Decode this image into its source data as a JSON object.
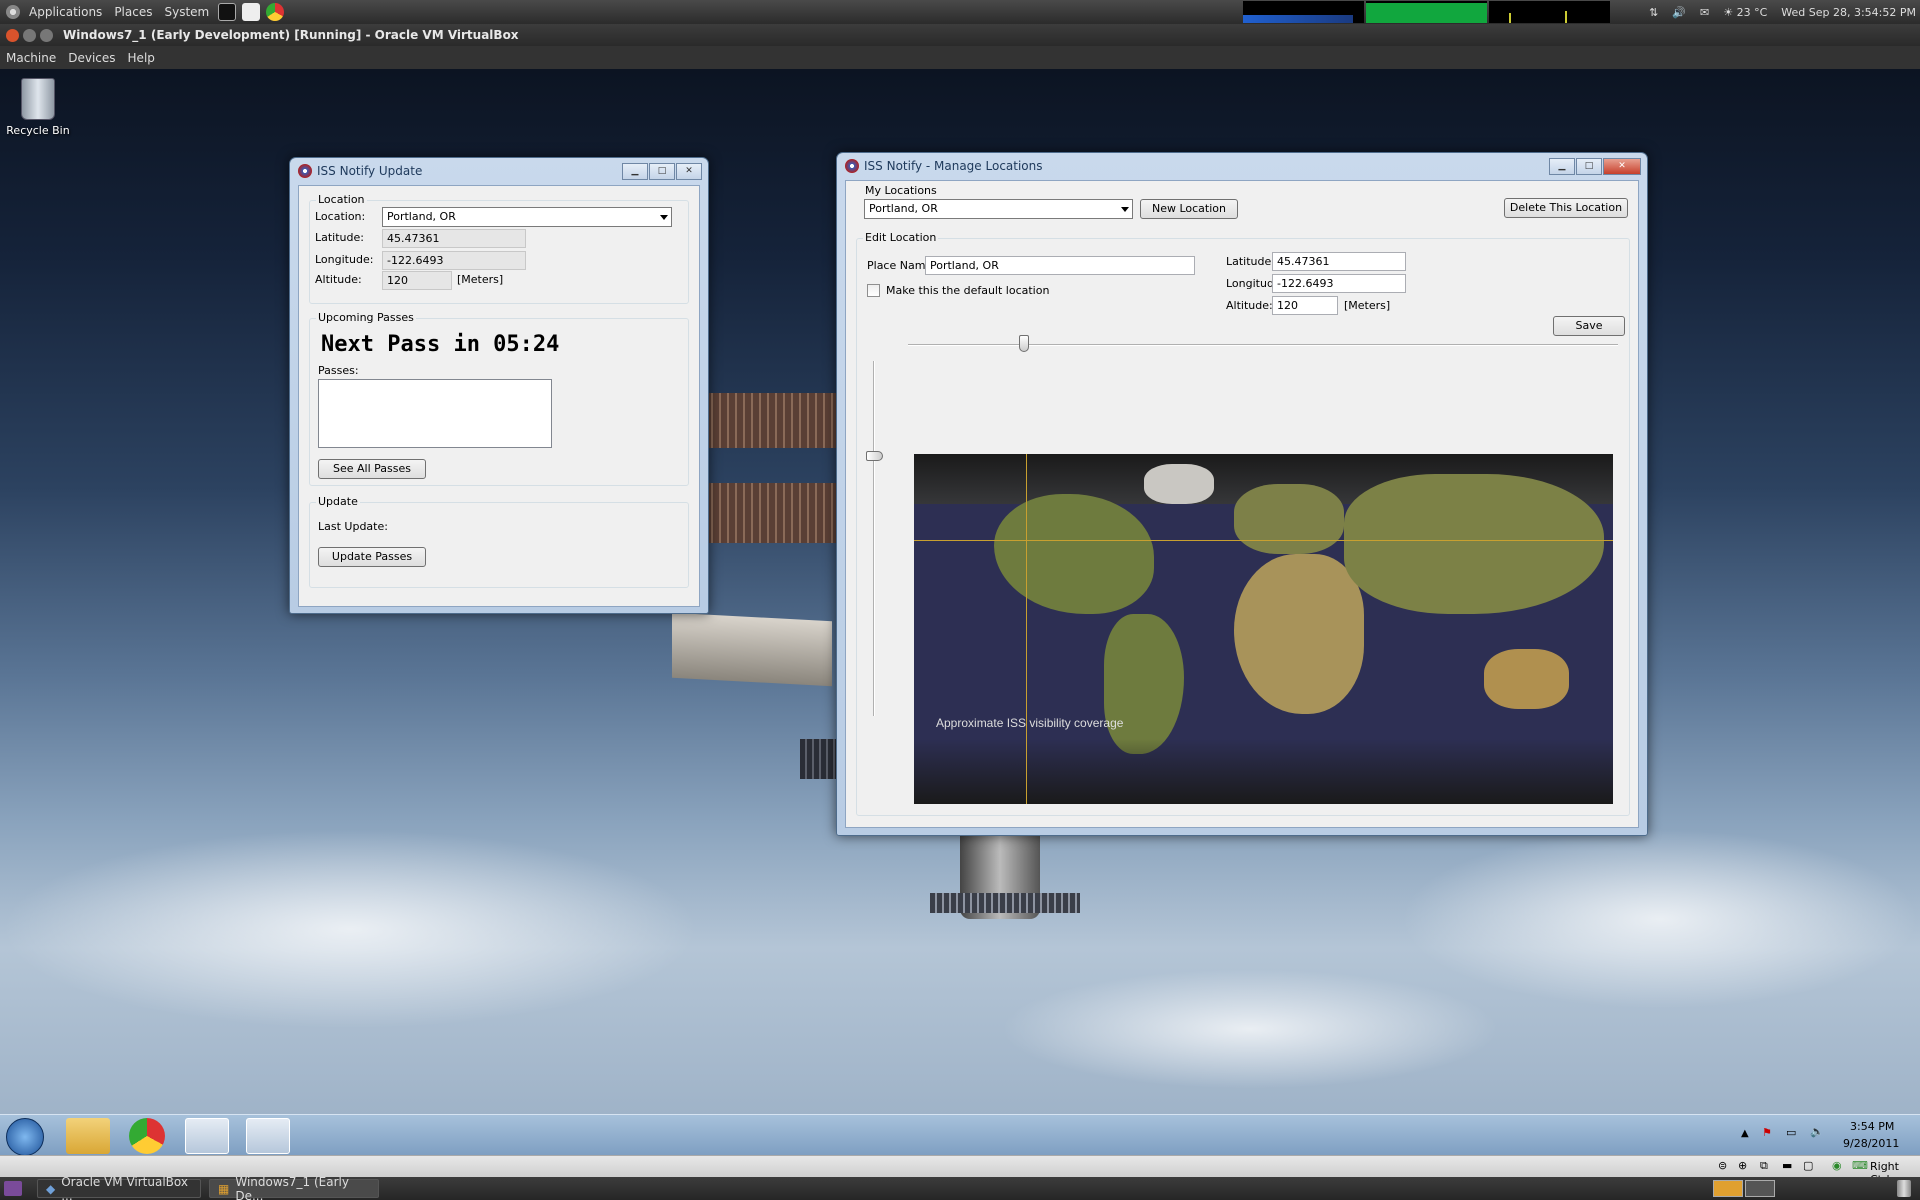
{
  "host_panel": {
    "menus": [
      "Applications",
      "Places",
      "System"
    ],
    "temperature": "23 °C",
    "clock": "Wed Sep 28, 3:54:52 PM"
  },
  "vbox": {
    "title": "Windows7_1 (Early Development) [Running] - Oracle VM VirtualBox",
    "menu": [
      "Machine",
      "Devices",
      "Help"
    ]
  },
  "desktop": {
    "recycle_bin": "Recycle Bin"
  },
  "update_window": {
    "title": "ISS Notify Update",
    "location_group": "Location",
    "location_label": "Location:",
    "location_value": "Portland, OR",
    "latitude_label": "Latitude:",
    "latitude_value": "45.47361",
    "longitude_label": "Longitude:",
    "longitude_value": "-122.6493",
    "altitude_label": "Altitude:",
    "altitude_value": "120",
    "altitude_unit": "[Meters]",
    "passes_group": "Upcoming Passes",
    "next_pass": "Next Pass in 05:24",
    "passes_label": "Passes:",
    "see_all": "See All Passes",
    "update_group": "Update",
    "last_update_label": "Last Update:",
    "update_button": "Update Passes"
  },
  "manage_window": {
    "title": "ISS Notify - Manage Locations",
    "my_locations": "My Locations",
    "selected_location": "Portland, OR",
    "new_location": "New Location",
    "delete_location": "Delete This Location",
    "edit_group": "Edit Location",
    "place_name_label": "Place Name:",
    "place_name_value": "Portland, OR",
    "default_checkbox": "Make this the default location",
    "latitude_label": "Latitude:",
    "latitude_value": "45.47361",
    "longitude_label": "Longitude:",
    "longitude_value": "-122.6493",
    "altitude_label": "Altitude:",
    "altitude_value": "120",
    "altitude_unit": "[Meters]",
    "save": "Save",
    "map_caption": "Approximate ISS visibility coverage"
  },
  "win_taskbar": {
    "time": "3:54 PM",
    "date": "9/28/2011"
  },
  "host_tray": {
    "host_key": "Right Ctrl"
  },
  "host_bottom": {
    "tasks": [
      "Oracle VM VirtualBox ...",
      "Windows7_1 (Early De..."
    ]
  }
}
